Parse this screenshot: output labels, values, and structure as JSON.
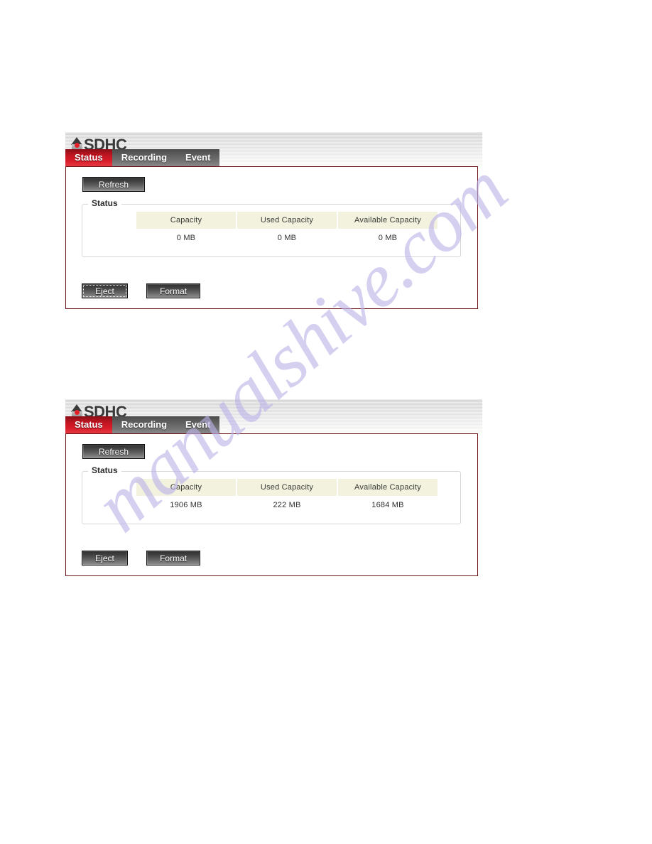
{
  "page": {
    "watermark": "manualshive.com"
  },
  "brand": {
    "name": "SDHC",
    "logo_icon": "sdhc-logo-icon"
  },
  "tabs": [
    {
      "label": "Status",
      "active": true
    },
    {
      "label": "Recording",
      "active": false
    },
    {
      "label": "Event",
      "active": false
    }
  ],
  "buttons": {
    "refresh": "Refresh",
    "eject": "Eject",
    "format": "Format"
  },
  "fieldset": {
    "legend": "Status"
  },
  "table": {
    "headers": [
      "Capacity",
      "Used Capacity",
      "Available Capacity"
    ]
  },
  "panels": [
    {
      "id": "panel-empty-card",
      "values": [
        "0 MB",
        "0 MB",
        "0 MB"
      ],
      "eject_focused": true
    },
    {
      "id": "panel-inserted-card",
      "values": [
        "1906 MB",
        "222 MB",
        "1684 MB"
      ],
      "eject_focused": false
    }
  ],
  "colors": {
    "active_tab": "#c31622",
    "panel_border": "#6e1418",
    "table_header_bg": "#f2f2df",
    "logo_dot": "#e8202c",
    "watermark": "#bcb2e8"
  }
}
